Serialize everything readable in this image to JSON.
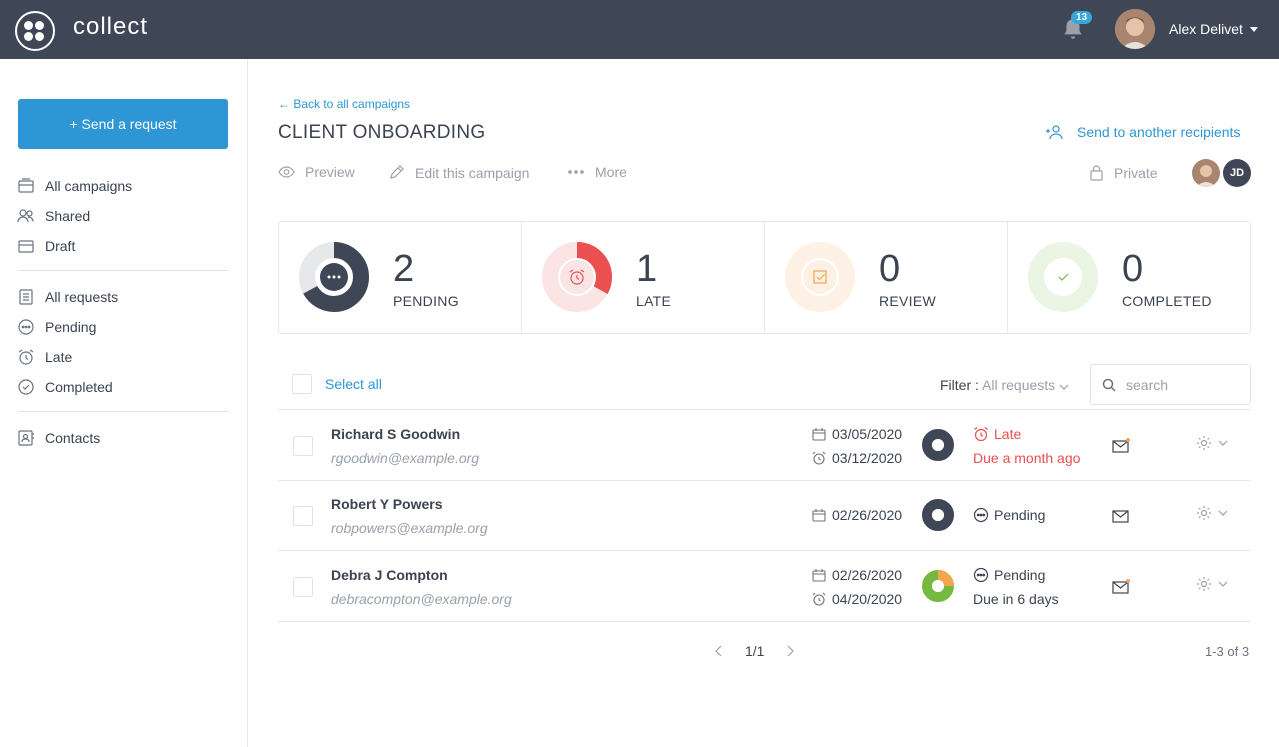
{
  "app": {
    "brand": "collect",
    "notifications_count": "13",
    "user_name": "Alex Delivet"
  },
  "sidebar": {
    "send_button": "+ Send a request",
    "campaign_items": [
      {
        "label": "All campaigns",
        "icon": "campaigns-icon"
      },
      {
        "label": "Shared",
        "icon": "shared-users-icon"
      },
      {
        "label": "Draft",
        "icon": "draft-icon"
      }
    ],
    "request_items": [
      {
        "label": "All requests",
        "icon": "requests-icon"
      },
      {
        "label": "Pending",
        "icon": "pending-icon"
      },
      {
        "label": "Late",
        "icon": "alarm-icon"
      },
      {
        "label": "Completed",
        "icon": "check-circle-icon"
      }
    ],
    "contact_items": [
      {
        "label": "Contacts",
        "icon": "contacts-icon"
      }
    ]
  },
  "campaign": {
    "back_link": "← Back to all campaigns",
    "title": "CLIENT ONBOARDING",
    "send_another": "Send to another recipients",
    "actions": {
      "preview": "Preview",
      "edit": "Edit this campaign",
      "more": "More",
      "private": "Private"
    },
    "members": [
      {
        "initials": "",
        "type": "photo"
      },
      {
        "initials": "JD",
        "type": "initials"
      }
    ]
  },
  "stats": [
    {
      "value": "2",
      "label": "PENDING",
      "color": "#3f4757",
      "fraction": 0.67
    },
    {
      "value": "1",
      "label": "LATE",
      "color": "#e9504f",
      "fraction": 0.33
    },
    {
      "value": "0",
      "label": "REVIEW",
      "color": "#f2a64e",
      "fraction": 0
    },
    {
      "value": "0",
      "label": "COMPLETED",
      "color": "#76b941",
      "fraction": 0
    }
  ],
  "table": {
    "select_all": "Select all",
    "filter_label": "Filter :",
    "filter_value": "All requests",
    "search_placeholder": "search",
    "rows": [
      {
        "name": "Richard S Goodwin",
        "email": "rgoodwin@example.org",
        "sent_date": "03/05/2020",
        "due_date": "03/12/2020",
        "status": "Late",
        "due_text": "Due a month ago",
        "progress": 0
      },
      {
        "name": "Robert Y Powers",
        "email": "robpowers@example.org",
        "sent_date": "02/26/2020",
        "due_date": "",
        "status": "Pending",
        "due_text": "",
        "progress": 0
      },
      {
        "name": "Debra J Compton",
        "email": "debracompton@example.org",
        "sent_date": "02/26/2020",
        "due_date": "04/20/2020",
        "status": "Pending",
        "due_text": "Due in 6 days",
        "progress": 0.75
      }
    ]
  },
  "pagination": {
    "page": "1/1",
    "range": "1-3 of 3"
  },
  "colors": {
    "accent": "#2e96d4",
    "topbar": "#3f4757",
    "late": "#e9504f",
    "review": "#f2a64e",
    "completed": "#76b941"
  }
}
